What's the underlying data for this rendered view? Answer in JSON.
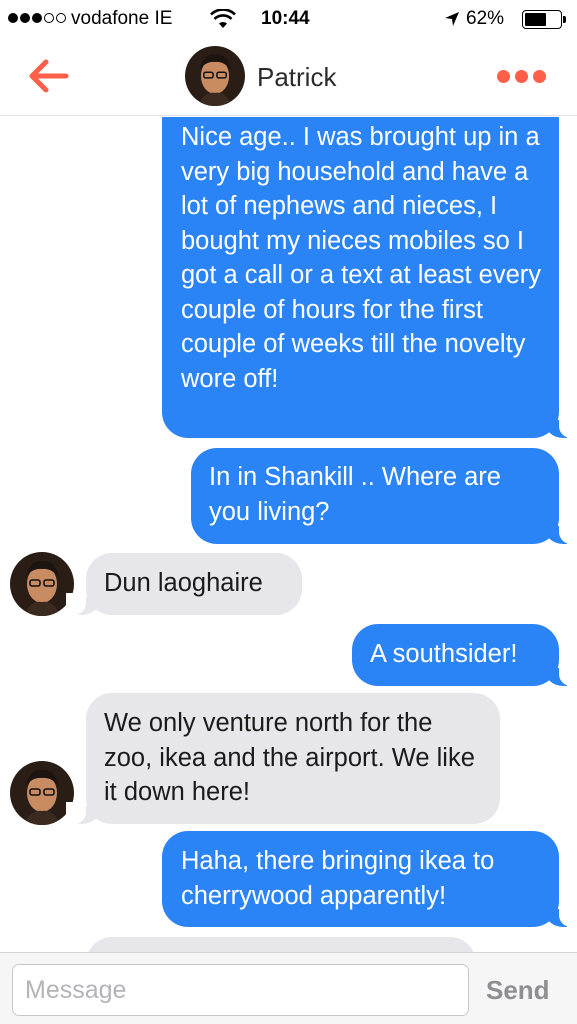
{
  "status_bar": {
    "carrier": "vodafone IE",
    "time": "10:44",
    "battery_percent": "62%",
    "battery_level": 0.62,
    "signal_bars_filled": 3,
    "signal_bars_total": 5
  },
  "header": {
    "contact_name": "Patrick",
    "accent_color": "#fd5f49"
  },
  "messages": [
    {
      "direction": "sent",
      "text": "Nice age.. I was brought up in a very big household and have a lot of nephews and nieces, I bought my nieces mobiles so I got a call or a text at least every couple of hours for the first couple of weeks till the novelty wore off!"
    },
    {
      "direction": "sent",
      "text": "In in Shankill .. Where are you living?"
    },
    {
      "direction": "received",
      "text": "Dun laoghaire"
    },
    {
      "direction": "sent",
      "text": "A southsider!"
    },
    {
      "direction": "received",
      "text": "We only venture north for the zoo, ikea and the airport. We like it down here!"
    },
    {
      "direction": "sent",
      "text": "Haha, there bringing ikea to cherrywood apparently!"
    },
    {
      "direction": "received",
      "text": ""
    }
  ],
  "composer": {
    "placeholder": "Message",
    "value": "",
    "send_label": "Send"
  },
  "colors": {
    "sent_bubble": "#2b84f5",
    "received_bubble": "#e6e6eb"
  }
}
